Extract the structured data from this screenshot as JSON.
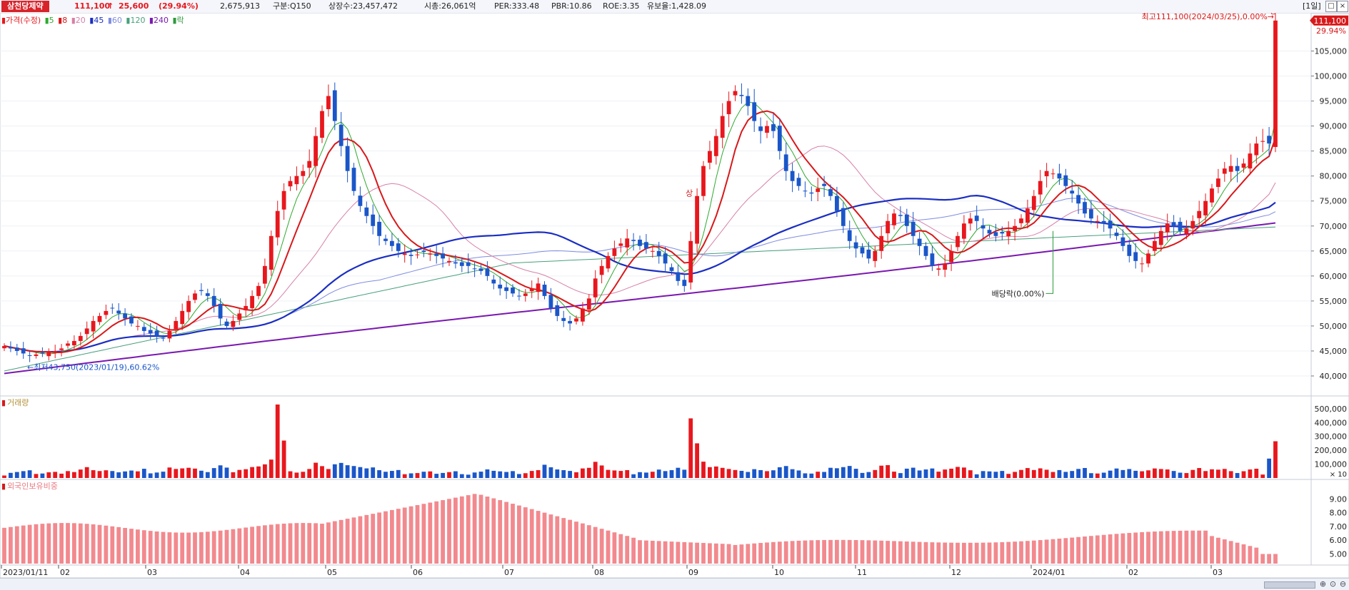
{
  "header": {
    "stock_name": "삼천당제약",
    "price": "111,100",
    "change_arrow": "↑",
    "change": "25,600",
    "change_pct": "(29.94%)",
    "volume": "2,675,913",
    "market": "구분:Q150",
    "shares": "상장수:23,457,472",
    "market_cap": "시총:26,061억",
    "per": "PER:333.48",
    "pbr": "PBR:10.86",
    "roe": "ROE:3.35",
    "float": "유보율:1,428.09",
    "period": "[1일]",
    "win_restore": "□",
    "win_close": "×"
  },
  "colors": {
    "up": "#e8171d",
    "down": "#1a56c9",
    "ma5": "#2eaa2e",
    "ma8": "#d8181a",
    "ma20": "#d77fa7",
    "ma45": "#1a2ec2",
    "ma60": "#7f8ce0",
    "ma120": "#48a07c",
    "ma240": "#7a18b0",
    "foreign": "#f2898e",
    "dividend": "#2e9a3c"
  },
  "price_panel": {
    "legend": [
      {
        "label": "가격(수정)",
        "color": "#e8171d"
      },
      {
        "label": "5",
        "color": "#2eaa2e"
      },
      {
        "label": "8",
        "color": "#d8181a"
      },
      {
        "label": "20",
        "color": "#d77fa7"
      },
      {
        "label": "45",
        "color": "#1a2ec2"
      },
      {
        "label": "60",
        "color": "#7f8ce0"
      },
      {
        "label": "120",
        "color": "#48a07c"
      },
      {
        "label": "240",
        "color": "#7a18b0"
      },
      {
        "label": "락",
        "color": "#2e9a3c"
      }
    ],
    "y_ticks": [
      "40,000",
      "45,000",
      "50,000",
      "55,000",
      "60,000",
      "65,000",
      "70,000",
      "75,000",
      "80,000",
      "85,000",
      "90,000",
      "95,000",
      "100,000",
      "105,000"
    ],
    "last_price_tag": "111,100",
    "last_pct_tag": "29.94%",
    "high_note": "최고111,100(2024/03/25),0.00%→",
    "low_note": "←최저43,750(2023/01/19),60.62%",
    "limit_up_mark": "상",
    "dividend_note": "배당락(0.00%)"
  },
  "volume_panel": {
    "legend": "거래량",
    "y_ticks": [
      "100,000",
      "200,000",
      "300,000",
      "400,000",
      "500,000"
    ],
    "multiplier": "× 10"
  },
  "foreign_panel": {
    "legend": "외국인보유비중",
    "y_ticks": [
      "5.00",
      "6.00",
      "7.00",
      "8.00",
      "9.00"
    ]
  },
  "x_axis": {
    "labels": [
      "2023/01/11",
      "02",
      "03",
      "04",
      "05",
      "06",
      "07",
      "08",
      "09",
      "10",
      "11",
      "12",
      "2024/01",
      "02",
      "03"
    ]
  },
  "chart_data": {
    "type": "candlestick",
    "title": "삼천당제약",
    "period": "daily",
    "date_range": [
      "2023/01/11",
      "2024/03/25"
    ],
    "price_ylim": [
      37000,
      111500
    ],
    "candles_close": [
      46000,
      45500,
      45000,
      44500,
      44000,
      44300,
      44500,
      44800,
      45000,
      45500,
      46500,
      47000,
      48000,
      49500,
      51000,
      52000,
      53000,
      53500,
      52500,
      51500,
      50500,
      50000,
      49000,
      48500,
      48000,
      47500,
      49000,
      51000,
      53000,
      55000,
      56500,
      57000,
      56000,
      54000,
      51500,
      50000,
      51000,
      52500,
      54000,
      56000,
      58000,
      62000,
      68000,
      73000,
      77000,
      79000,
      80000,
      81000,
      83000,
      88000,
      93000,
      96000,
      91000,
      86000,
      81000,
      77000,
      74000,
      72000,
      70000,
      68000,
      67000,
      66000,
      65000,
      64500,
      64000,
      64300,
      64800,
      64500,
      64000,
      63500,
      63000,
      62500,
      62000,
      62000,
      61500,
      61000,
      60000,
      58500,
      57500,
      57000,
      56500,
      56000,
      56500,
      57500,
      58500,
      56000,
      53500,
      52000,
      51000,
      50500,
      51500,
      53500,
      55500,
      59500,
      62000,
      64000,
      65500,
      66500,
      67500,
      67000,
      66000,
      65500,
      65000,
      64000,
      62500,
      61000,
      59000,
      58000,
      67000,
      76000,
      82000,
      85000,
      88000,
      92000,
      95000,
      97000,
      96000,
      94000,
      91000,
      89000,
      90000,
      89000,
      85000,
      81000,
      79000,
      78000,
      77000,
      76500,
      77500,
      78000,
      76000,
      73000,
      70000,
      67000,
      65500,
      64500,
      63500,
      65000,
      68000,
      71000,
      72500,
      72000,
      70000,
      68000,
      66000,
      64000,
      62000,
      61500,
      62500,
      65000,
      68000,
      70500,
      71500,
      71000,
      69500,
      68500,
      68000,
      68500,
      69000,
      70000,
      71500,
      73500,
      76000,
      79000,
      81000,
      80500,
      79500,
      78000,
      76500,
      74500,
      72500,
      71500,
      71000,
      70500,
      69500,
      68000,
      66000,
      64000,
      63000,
      62500,
      64500,
      67000,
      69000,
      70500,
      70000,
      69000,
      69500,
      71000,
      73000,
      75000,
      77500,
      79500,
      81500,
      82000,
      81000,
      82500,
      84500,
      86500,
      87000,
      86500,
      111100
    ],
    "ma5_note": "moving averages 5/8/20/45/60/120/240",
    "volume_max": 530000,
    "foreign_ylim": [
      4.3,
      10.0
    ]
  }
}
